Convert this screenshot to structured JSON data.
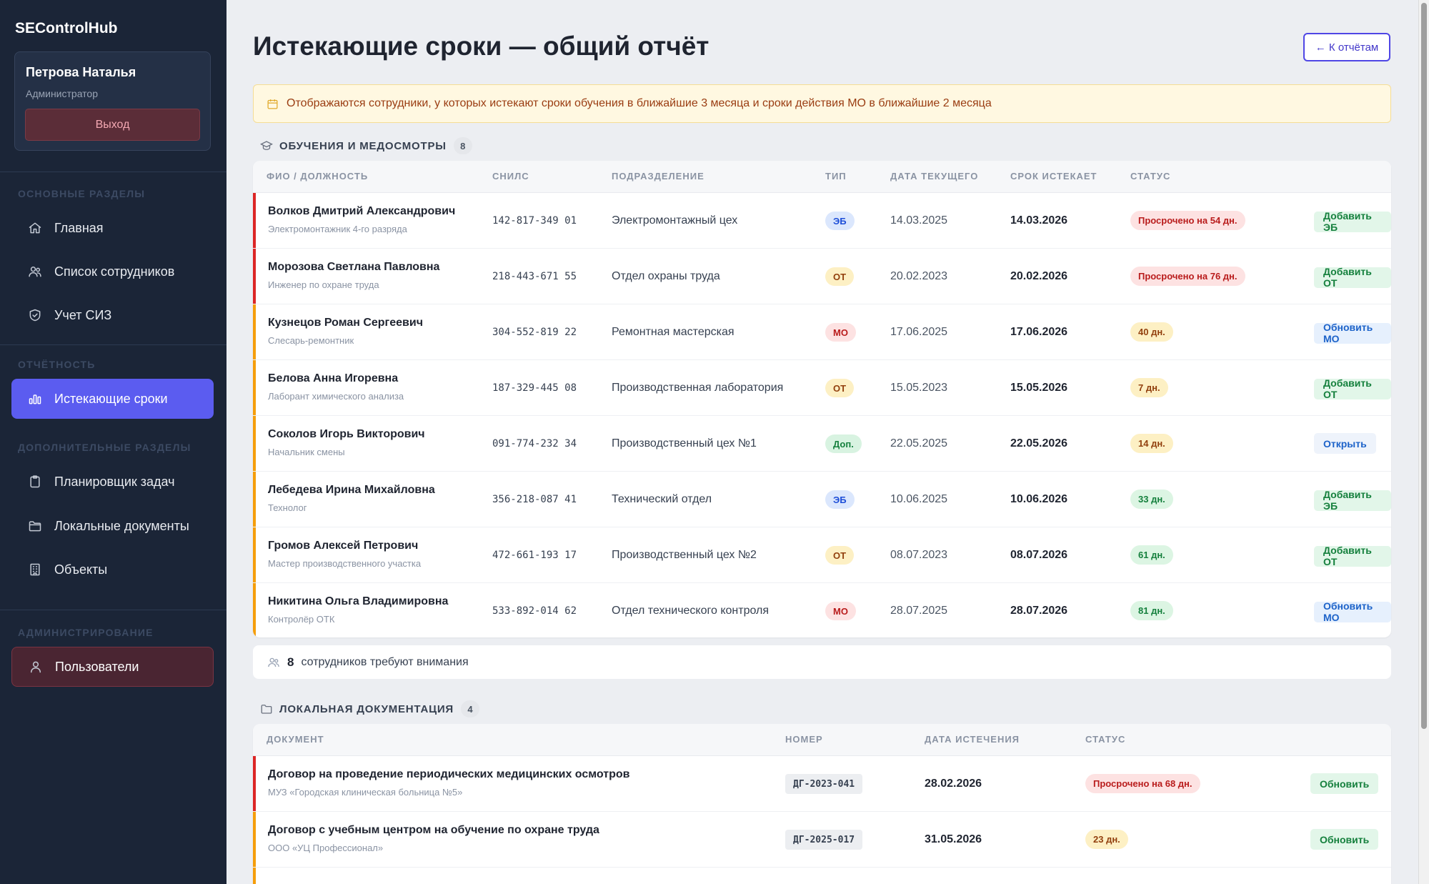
{
  "app": {
    "brand": "SEControlHub"
  },
  "user": {
    "name": "Петрова Наталья",
    "role": "Администратор",
    "logout": "Выход"
  },
  "sidebar": {
    "sections": [
      {
        "title": "ОСНОВНЫЕ РАЗДЕЛЫ",
        "items": [
          {
            "label": "Главная",
            "icon": "home-icon"
          },
          {
            "label": "Список сотрудников",
            "icon": "users-icon"
          },
          {
            "label": "Учет СИЗ",
            "icon": "shield-icon"
          }
        ]
      },
      {
        "title": "ОТЧЁТНОСТЬ",
        "items": [
          {
            "label": "Истекающие сроки",
            "icon": "bar-chart-icon",
            "active": true
          }
        ]
      },
      {
        "title": "ДОПОЛНИТЕЛЬНЫЕ РАЗДЕЛЫ",
        "items": [
          {
            "label": "Планировщик задач",
            "icon": "clipboard-icon"
          },
          {
            "label": "Локальные документы",
            "icon": "folder-icon"
          },
          {
            "label": "Объекты",
            "icon": "building-icon"
          }
        ]
      },
      {
        "title": "АДМИНИСТРИРОВАНИЕ",
        "items": [
          {
            "label": "Пользователи",
            "icon": "user-icon"
          }
        ]
      }
    ]
  },
  "page": {
    "title": "Истекающие сроки — общий отчёт",
    "back": "← К отчётам"
  },
  "notice": "Отображаются сотрудники, у которых истекают сроки обучения в ближайшие 3 месяца и сроки действия МО в ближайшие 2 месяца",
  "trainings": {
    "title": "ОБУЧЕНИЯ И МЕДОСМОТРЫ",
    "count": "8",
    "columns": [
      "ФИО / ДОЛЖНОСТЬ",
      "СНИЛС",
      "ПОДРАЗДЕЛЕНИЕ",
      "ТИП",
      "ДАТА ТЕКУЩЕГО",
      "СРОК ИСТЕКАЕТ",
      "СТАТУС"
    ],
    "rows": [
      {
        "name": "Волков Дмитрий Александрович",
        "position": "Электромонтажник 4-го разряда",
        "snils": "142-817-349 01",
        "dept": "Электромонтажный цех",
        "type": "ЭБ",
        "current": "14.03.2025",
        "expires": "14.03.2026",
        "status": "Просрочено на 54 дн.",
        "severity": "overdue",
        "action": "Добавить ЭБ"
      },
      {
        "name": "Морозова Светлана Павловна",
        "position": "Инженер по охране труда",
        "snils": "218-443-671 55",
        "dept": "Отдел охраны труда",
        "type": "ОТ",
        "current": "20.02.2023",
        "expires": "20.02.2026",
        "status": "Просрочено на 76 дн.",
        "severity": "overdue",
        "action": "Добавить ОТ"
      },
      {
        "name": "Кузнецов Роман Сергеевич",
        "position": "Слесарь-ремонтник",
        "snils": "304-552-819 22",
        "dept": "Ремонтная мастерская",
        "type": "МО",
        "current": "17.06.2025",
        "expires": "17.06.2026",
        "status": "40 дн.",
        "severity": "warning",
        "action": "Обновить МО"
      },
      {
        "name": "Белова Анна Игоревна",
        "position": "Лаборант химического анализа",
        "snils": "187-329-445 08",
        "dept": "Производственная лаборатория",
        "type": "ОТ",
        "current": "15.05.2023",
        "expires": "15.05.2026",
        "status": "7 дн.",
        "severity": "warning",
        "action": "Добавить ОТ"
      },
      {
        "name": "Соколов Игорь Викторович",
        "position": "Начальник смены",
        "snils": "091-774-232 34",
        "dept": "Производственный цех №1",
        "type": "Доп.",
        "current": "22.05.2025",
        "expires": "22.05.2026",
        "status": "14 дн.",
        "severity": "warning",
        "action": "Открыть"
      },
      {
        "name": "Лебедева Ирина Михайловна",
        "position": "Технолог",
        "snils": "356-218-087 41",
        "dept": "Технический отдел",
        "type": "ЭБ",
        "current": "10.06.2025",
        "expires": "10.06.2026",
        "status": "33 дн.",
        "severity": "ok",
        "action": "Добавить ЭБ"
      },
      {
        "name": "Громов Алексей Петрович",
        "position": "Мастер производственного участка",
        "snils": "472-661-193 17",
        "dept": "Производственный цех №2",
        "type": "ОТ",
        "current": "08.07.2023",
        "expires": "08.07.2026",
        "status": "61 дн.",
        "severity": "ok",
        "action": "Добавить ОТ"
      },
      {
        "name": "Никитина Ольга Владимировна",
        "position": "Контролёр ОТК",
        "snils": "533-892-014 62",
        "dept": "Отдел технического контроля",
        "type": "МО",
        "current": "28.07.2025",
        "expires": "28.07.2026",
        "status": "81 дн.",
        "severity": "ok",
        "action": "Обновить МО"
      }
    ]
  },
  "summary": {
    "count": "8",
    "text": "сотрудников требуют внимания"
  },
  "documents": {
    "title": "ЛОКАЛЬНАЯ ДОКУМЕНТАЦИЯ",
    "count": "4",
    "columns": [
      "ДОКУМЕНТ",
      "НОМЕР",
      "ДАТА ИСТЕЧЕНИЯ",
      "СТАТУС"
    ],
    "rows": [
      {
        "title": "Договор на проведение периодических медицинских осмотров",
        "org": "МУЗ «Городская клиническая больница №5»",
        "number": "ДГ-2023-041",
        "expires": "28.02.2026",
        "status": "Просрочено на 68 дн.",
        "severity": "overdue",
        "action": "Обновить"
      },
      {
        "title": "Договор с учебным центром на обучение по охране труда",
        "org": "ООО «УЦ Профессионал»",
        "number": "ДГ-2025-017",
        "expires": "31.05.2026",
        "status": "23 дн.",
        "severity": "warning",
        "action": "Обновить"
      }
    ]
  },
  "colors": {
    "accent": "#5b5cf0",
    "overdue": "#dc2626",
    "warning": "#f59e0b",
    "ok": "#16a34a",
    "sidebar": "#1b2537"
  }
}
